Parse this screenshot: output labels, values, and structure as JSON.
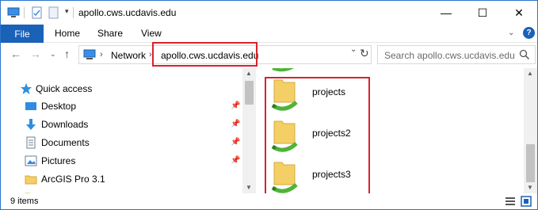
{
  "window": {
    "title": "apollo.cws.ucdavis.edu",
    "minimize_glyph": "—",
    "maximize_glyph": "☐",
    "close_glyph": "✕"
  },
  "ribbon": {
    "tabs": [
      "File",
      "Home",
      "Share",
      "View"
    ],
    "help_glyph": "?",
    "expand_glyph": "⌄"
  },
  "address": {
    "breadcrumbs": [
      "Network",
      "apollo.cws.ucdavis.edu"
    ],
    "separator": "›",
    "search_placeholder": "Search apollo.cws.ucdavis.edu"
  },
  "navigation": {
    "quick_access_label": "Quick access",
    "items": [
      {
        "label": "Desktop",
        "icon": "desktop-icon",
        "pinned": true
      },
      {
        "label": "Downloads",
        "icon": "download-icon",
        "pinned": true
      },
      {
        "label": "Documents",
        "icon": "documents-icon",
        "pinned": true
      },
      {
        "label": "Pictures",
        "icon": "pictures-icon",
        "pinned": true
      },
      {
        "label": "ArcGIS Pro 3.1",
        "icon": "folder-icon",
        "pinned": false
      }
    ]
  },
  "content": {
    "folders": [
      "projects",
      "projects2",
      "projects3"
    ]
  },
  "status": {
    "item_count": "9 items"
  },
  "colors": {
    "accent": "#1a61b8",
    "highlight": "#d9222b",
    "folder": "#f3cf66"
  }
}
